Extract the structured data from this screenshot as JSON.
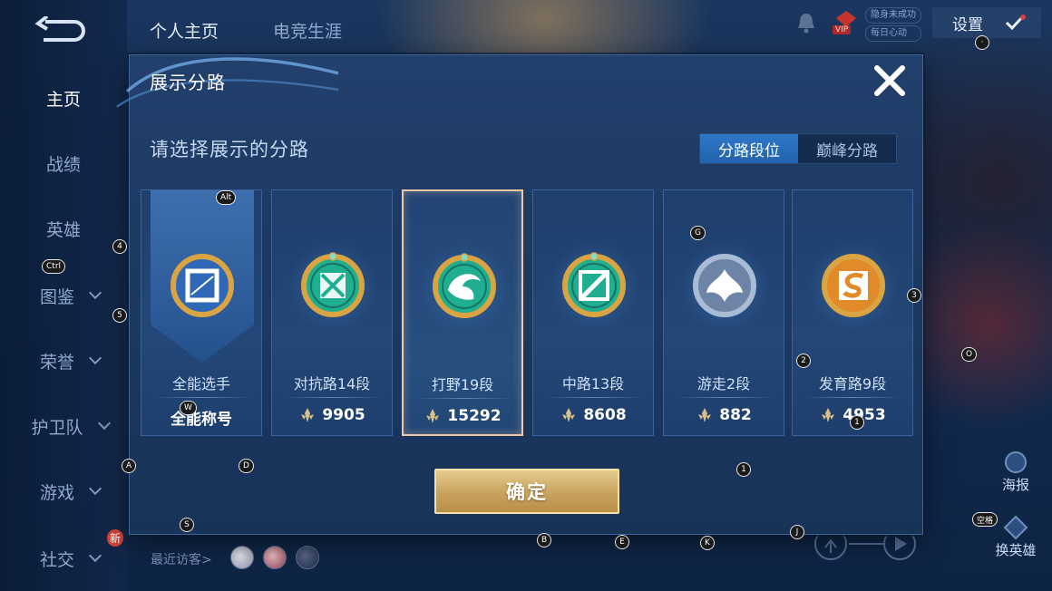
{
  "nav": {
    "items": [
      {
        "label": "主页",
        "active": true,
        "chevron": false
      },
      {
        "label": "战绩",
        "active": false,
        "chevron": false
      },
      {
        "label": "英雄",
        "active": false,
        "chevron": false
      },
      {
        "label": "图鉴",
        "active": false,
        "chevron": true
      },
      {
        "label": "荣誉",
        "active": false,
        "chevron": true
      },
      {
        "label": "护卫队",
        "active": false,
        "chevron": true
      },
      {
        "label": "游戏",
        "active": false,
        "chevron": true
      },
      {
        "label": "社交",
        "active": false,
        "chevron": true
      }
    ],
    "new_badge": "新"
  },
  "top_tabs": {
    "profile": "个人主页",
    "career": "电竞生涯"
  },
  "top_right": {
    "vip": "VIP",
    "mini1": "隐身未成功",
    "mini2": "每日心动",
    "settings": "设置"
  },
  "right_side": {
    "poster": "海报",
    "change_hero": "换英雄"
  },
  "visitors": {
    "label": "最近访客>"
  },
  "dialog": {
    "title": "展示分路",
    "subtitle": "请选择展示的分路",
    "segments": [
      {
        "label": "分路段位",
        "active": true
      },
      {
        "label": "巅峰分路",
        "active": false
      }
    ],
    "cards": [
      {
        "name": "全能选手",
        "score": "全能称号",
        "has_points_icon": false,
        "selected": false,
        "emblem": "all-round",
        "banner": true
      },
      {
        "name": "对抗路14段",
        "score": "9905",
        "has_points_icon": true,
        "selected": false,
        "emblem": "clash-lane",
        "banner": false
      },
      {
        "name": "打野19段",
        "score": "15292",
        "has_points_icon": true,
        "selected": true,
        "emblem": "jungle",
        "banner": false
      },
      {
        "name": "中路13段",
        "score": "8608",
        "has_points_icon": true,
        "selected": false,
        "emblem": "mid-lane",
        "banner": false
      },
      {
        "name": "游走2段",
        "score": "882",
        "has_points_icon": true,
        "selected": false,
        "emblem": "roam",
        "banner": false
      },
      {
        "name": "发育路9段",
        "score": "4953",
        "has_points_icon": true,
        "selected": false,
        "emblem": "farm-lane",
        "banner": false
      }
    ],
    "confirm": "确定"
  },
  "colors": {
    "accent_blue": "#2f79c9",
    "selected_border": "#f0c8a8",
    "confirm_gold": "#caa661",
    "emblem_green": "#1fae8f",
    "emblem_gold": "#d9a441",
    "emblem_silver": "#a9bcd6",
    "emblem_orange": "#e08a2a"
  },
  "hints": [
    {
      "key": "Alt"
    },
    {
      "key": "4"
    },
    {
      "key": "Ctrl"
    },
    {
      "key": "5"
    },
    {
      "key": "W"
    },
    {
      "key": "A"
    },
    {
      "key": "D"
    },
    {
      "key": "S"
    },
    {
      "key": "G"
    },
    {
      "key": "3"
    },
    {
      "key": "2"
    },
    {
      "key": "O"
    },
    {
      "key": "1"
    },
    {
      "key": "1"
    },
    {
      "key": "B"
    },
    {
      "key": "E"
    },
    {
      "key": "K"
    },
    {
      "key": "J"
    },
    {
      "key": "空格"
    },
    {
      "key": "·"
    }
  ]
}
